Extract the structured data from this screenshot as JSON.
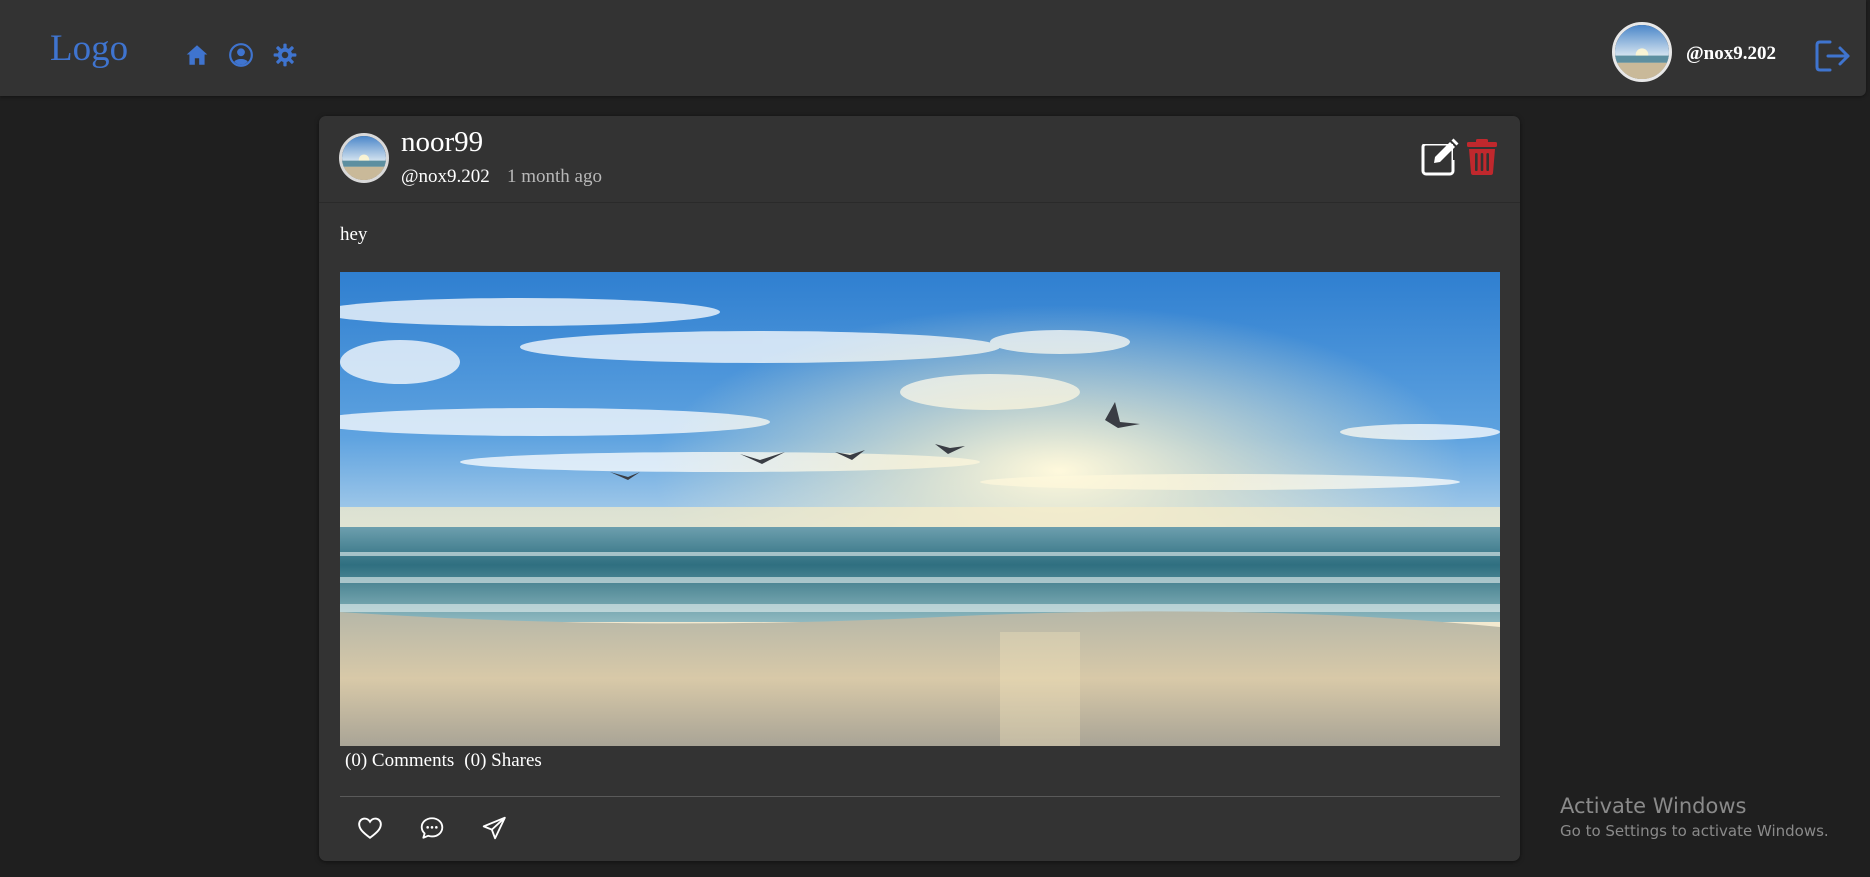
{
  "navbar": {
    "logo": "Logo",
    "icons": [
      "home-icon",
      "user-circle-icon",
      "gear-icon"
    ],
    "username": "@nox9.202",
    "logout_icon": "logout-icon",
    "accent_color": "#3f74cf"
  },
  "post": {
    "name": "noor99",
    "handle": "@nox9.202",
    "time": "1 month ago",
    "text": "hey",
    "comments": "(0) Comments",
    "shares": "(0) Shares",
    "actions": [
      "heart-icon",
      "comment-icon",
      "send-icon"
    ],
    "delete_color": "#c0282d"
  },
  "watermark": {
    "title": "Activate Windows",
    "subtitle": "Go to Settings to activate Windows."
  }
}
